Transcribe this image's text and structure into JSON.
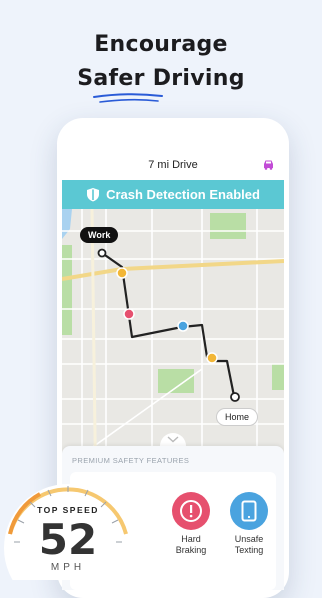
{
  "headline": {
    "line1": "Encourage",
    "line2": "Safer Driving"
  },
  "trip": {
    "title": "7 mi Drive"
  },
  "banner": {
    "text": "Crash Detection Enabled"
  },
  "map": {
    "start_label": "Work",
    "end_label": "Home"
  },
  "panel": {
    "title": "PREMIUM SAFETY FEATURES",
    "features": [
      {
        "label_line1": "Hard",
        "label_line2": "Braking",
        "icon": "exclamation-icon",
        "color": "#e6506e"
      },
      {
        "label_line1": "Unsafe",
        "label_line2": "Texting",
        "icon": "phone-icon",
        "color": "#4aa3df"
      }
    ]
  },
  "speed": {
    "top_label": "TOP SPEED",
    "value": "52",
    "unit": "MPH"
  },
  "colors": {
    "accent_teal": "#5bc8d3",
    "route": "#222222",
    "map_bg": "#e9e8e4",
    "park_green": "#b9dea5",
    "water": "#a9d2f0",
    "underline": "#2a5bd7"
  }
}
